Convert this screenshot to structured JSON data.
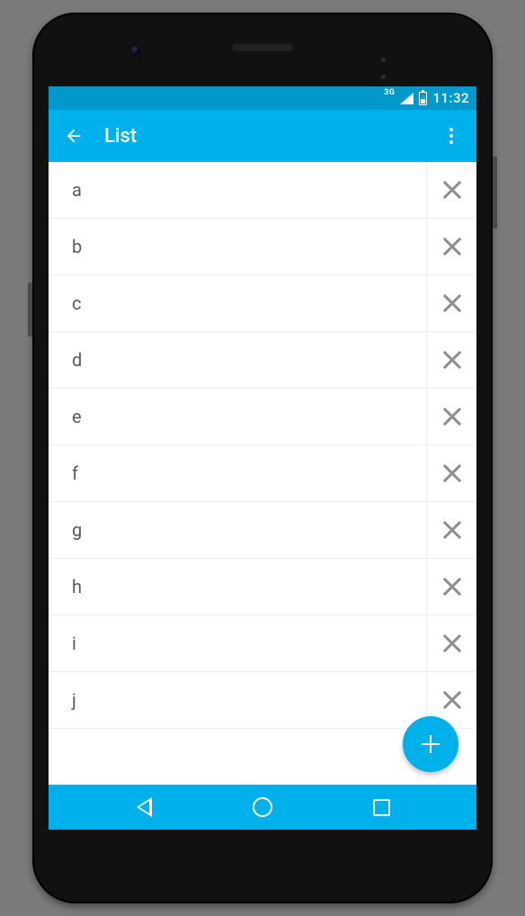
{
  "colors": {
    "primary": "#00B0EA",
    "primaryDark": "#0099CC",
    "rowDivider": "#eceff1",
    "xIcon": "#8e8e8e",
    "text": "#5a5a5a"
  },
  "status": {
    "network": "3G",
    "time": "11:32"
  },
  "appbar": {
    "title": "List"
  },
  "list": {
    "items": [
      {
        "label": "a"
      },
      {
        "label": "b"
      },
      {
        "label": "c"
      },
      {
        "label": "d"
      },
      {
        "label": "e"
      },
      {
        "label": "f"
      },
      {
        "label": "g"
      },
      {
        "label": "h"
      },
      {
        "label": "i"
      },
      {
        "label": "j"
      }
    ]
  }
}
